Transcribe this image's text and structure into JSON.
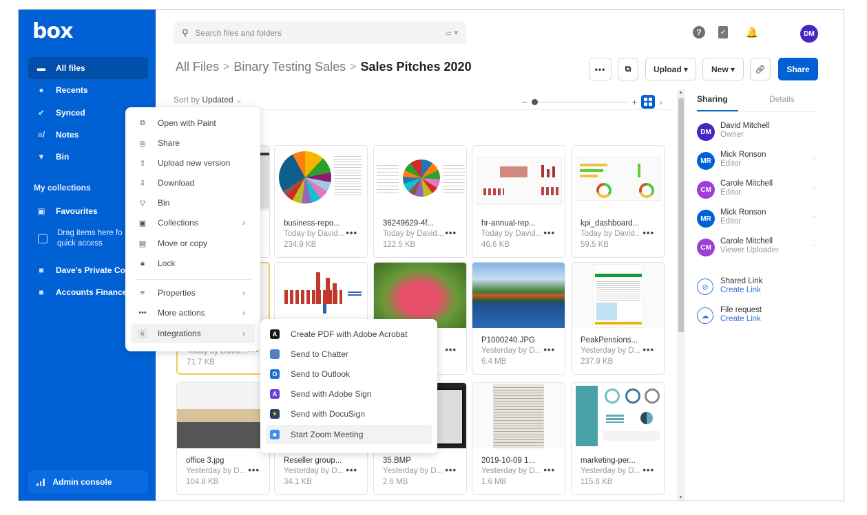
{
  "app": {
    "logo": "box"
  },
  "sidebar": {
    "items": [
      {
        "label": "All files",
        "icon": "folder-icon",
        "active": true
      },
      {
        "label": "Recents",
        "icon": "clock-icon"
      },
      {
        "label": "Synced",
        "icon": "check-circle-icon"
      },
      {
        "label": "Notes",
        "icon": "notes-icon"
      },
      {
        "label": "Bin",
        "icon": "trash-icon"
      }
    ],
    "collections_title": "My collections",
    "collections": [
      {
        "label": "Favourites",
        "icon": "star-collection-icon"
      },
      {
        "label": "Dave's Private Colle",
        "icon": "collection-icon"
      },
      {
        "label": "Accounts Finances",
        "icon": "collection-icon"
      }
    ],
    "drag_hint_line1": "Drag items here fo",
    "drag_hint_line2": "quick access",
    "admin_console": "Admin console"
  },
  "header": {
    "search_placeholder": "Search files and folders",
    "avatar_initials": "DM",
    "help": "?",
    "bell": "🔔"
  },
  "breadcrumb": {
    "items": [
      "All Files",
      "Binary Testing Sales"
    ],
    "current": "Sales Pitches 2020",
    "separator": ">"
  },
  "toolbar": {
    "more": "•••",
    "upload": "Upload ▾",
    "new": "New ▾",
    "share": "Share"
  },
  "view": {
    "sort_prefix": "Sort by",
    "sort_value": "Updated",
    "sort_chevron": "⌄",
    "zoom_level": 0
  },
  "files": [
    {
      "name": "business-repo...",
      "meta": "Today by David...",
      "size": "234.9 KB"
    },
    {
      "name": "36249629-4f...",
      "meta": "Today by David...",
      "size": "122.5 KB"
    },
    {
      "name": "hr-annual-rep...",
      "meta": "Today by David...",
      "size": "46.6 KB"
    },
    {
      "name": "kpi_dashboard...",
      "meta": "Today by David...",
      "size": "59.5 KB"
    },
    {
      "name": "",
      "meta": "Today by David...",
      "size": "71.7 KB"
    },
    {
      "name": "",
      "meta": "",
      "size": ""
    },
    {
      "name": "",
      "meta": "",
      "size": ""
    },
    {
      "name": "P1000240.JPG",
      "meta": "Yesterday by D...",
      "size": "6.4 MB"
    },
    {
      "name": "PeakPensions...",
      "meta": "Yesterday by D...",
      "size": "237.9 KB"
    },
    {
      "name": "office 3.jpg",
      "meta": "Yesterday by D...",
      "size": "104.8 KB"
    },
    {
      "name": "Reseller group...",
      "meta": "Yesterday by D...",
      "size": "34.1 KB"
    },
    {
      "name": "35.BMP",
      "meta": "Yesterday by D...",
      "size": "2.6 MB"
    },
    {
      "name": "2019-10-09 1...",
      "meta": "Yesterday by D...",
      "size": "1.6 MB"
    },
    {
      "name": "marketing-per...",
      "meta": "Yesterday by D...",
      "size": "115.8 KB"
    }
  ],
  "right_panel": {
    "tabs": [
      "Sharing",
      "Details"
    ],
    "people": [
      {
        "initials": "DM",
        "name": "David Mitchell",
        "role": "Owner",
        "color": "#4826c2"
      },
      {
        "initials": "MR",
        "name": "Mick Ronson",
        "role": "Editor",
        "color": "#0061d5"
      },
      {
        "initials": "CM",
        "name": "Carole Mitchell",
        "role": "Editor",
        "color": "#9b3fd6"
      },
      {
        "initials": "MR",
        "name": "Mick Ronson",
        "role": "Editor",
        "color": "#0061d5"
      },
      {
        "initials": "CM",
        "name": "Carole Mitchell",
        "role": "Viewer Uploader",
        "color": "#9b3fd6"
      }
    ],
    "shared_link_title": "Shared Link",
    "shared_link_action": "Create Link",
    "file_request_title": "File request",
    "file_request_action": "Create Link",
    "more": "···"
  },
  "context_menu": {
    "items": [
      {
        "label": "Open with Paint",
        "icon": "open-external-icon"
      },
      {
        "label": "Share",
        "icon": "share-user-icon"
      },
      {
        "label": "Upload new version",
        "icon": "upload-icon"
      },
      {
        "label": "Download",
        "icon": "download-icon"
      },
      {
        "label": "Bin",
        "icon": "trash-icon"
      },
      {
        "label": "Collections",
        "icon": "collections-icon",
        "submenu": true
      },
      {
        "label": "Move or copy",
        "icon": "move-copy-icon"
      },
      {
        "label": "Lock",
        "icon": "lock-icon"
      },
      {
        "label": "Properties",
        "icon": "properties-icon",
        "submenu": true
      },
      {
        "label": "More actions",
        "icon": "more-icon",
        "submenu": true
      },
      {
        "label": "Integrations",
        "icon": "integrations-icon",
        "submenu": true,
        "badge": "6"
      }
    ]
  },
  "integrations_menu": {
    "items": [
      {
        "label": "Create PDF with Adobe Acrobat",
        "icon": "adobe-acrobat-icon",
        "color": "#1b1b1b"
      },
      {
        "label": "Send to Chatter",
        "icon": "chatter-icon",
        "color": "#3b86d9"
      },
      {
        "label": "Send to Outlook",
        "icon": "outlook-icon",
        "color": "#1f6fd0"
      },
      {
        "label": "Send with Adobe Sign",
        "icon": "adobe-sign-icon",
        "color": "#6f3fd6"
      },
      {
        "label": "Send with DocuSign",
        "icon": "docusign-icon",
        "color": "#27406e"
      },
      {
        "label": "Start Zoom Meeting",
        "icon": "zoom-icon",
        "color": "#3b8ff0"
      }
    ]
  },
  "colors": {
    "brand": "#0061d5",
    "sidebar_active": "#004ea8"
  }
}
